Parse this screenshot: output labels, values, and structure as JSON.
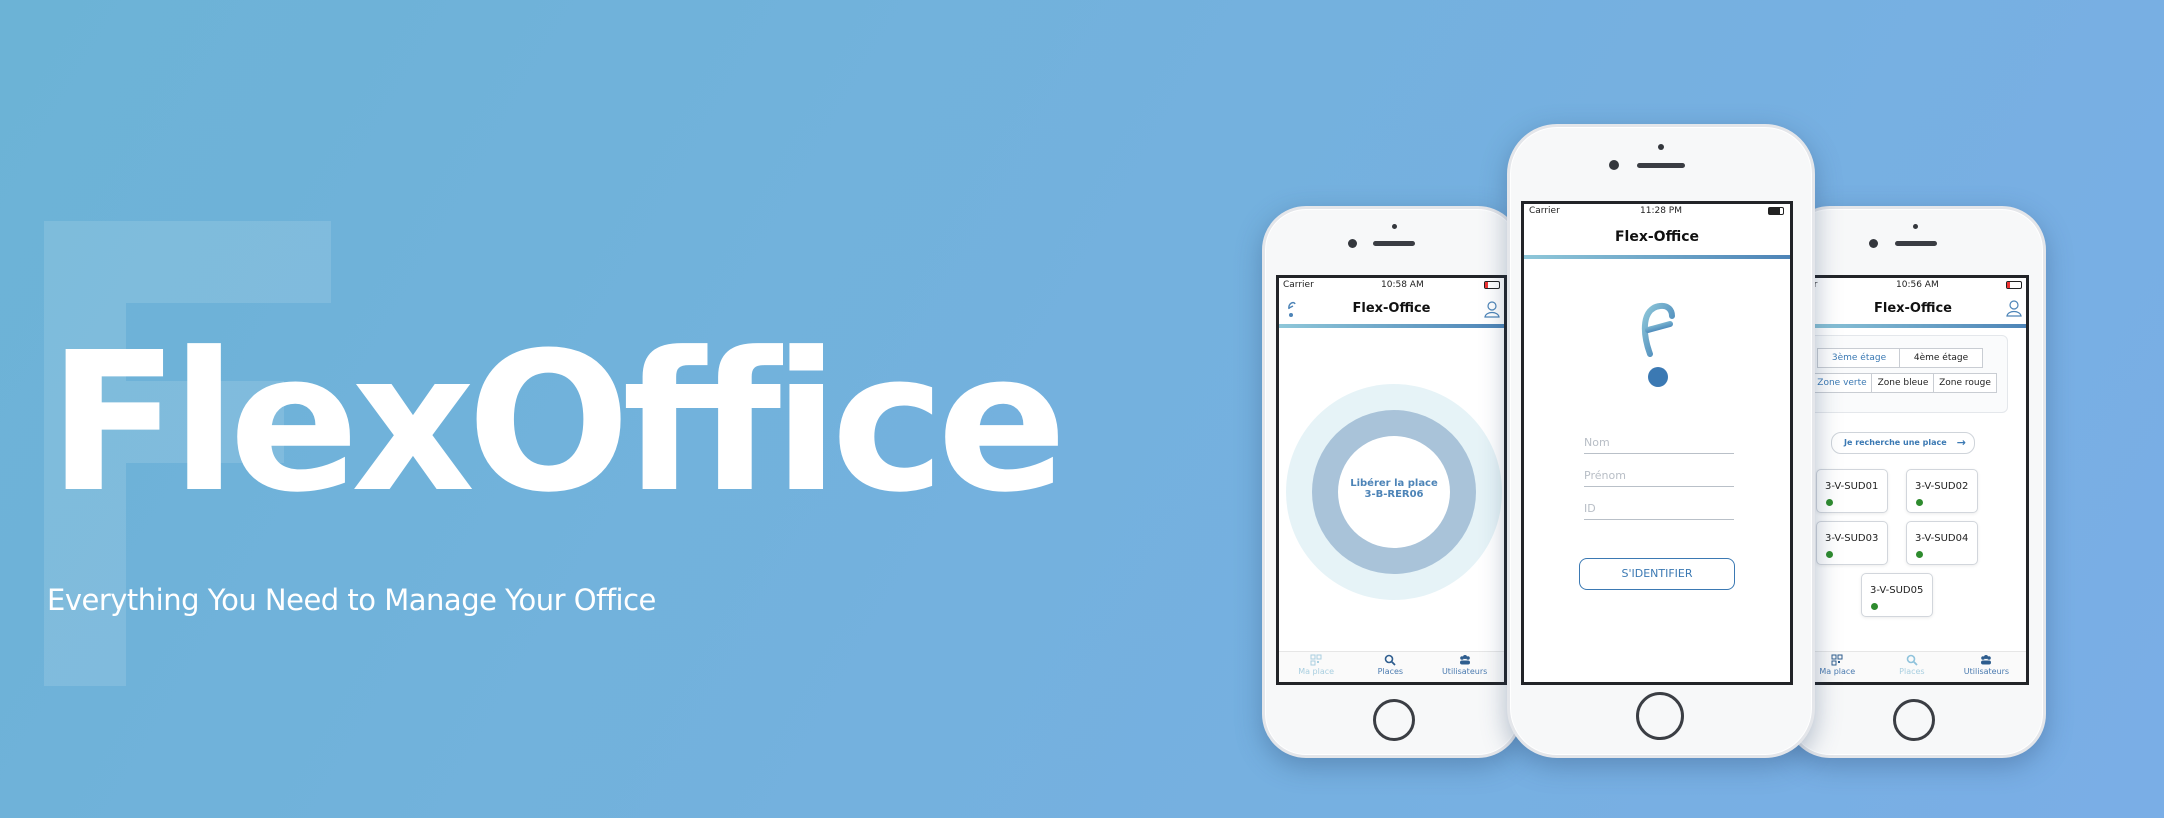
{
  "colors": {
    "accent_blue": "#3b79b3",
    "available_green": "#2e8b2e",
    "background": "#74b1de"
  },
  "banner": {
    "title": "FlexOffice",
    "tagline": "Everything You Need to Manage Your Office"
  },
  "phone_left": {
    "carrier": "Carrier",
    "time": "10:58 AM",
    "app_title": "Flex-Office",
    "release_line1": "Libérer la place",
    "release_line2": "3-B-RER06",
    "tabs": [
      "Ma place",
      "Places",
      "Utilisateurs"
    ]
  },
  "phone_center": {
    "carrier": "Carrier",
    "time": "11:28 PM",
    "app_title": "Flex-Office",
    "fields": {
      "name_placeholder": "Nom",
      "firstname_placeholder": "Prénom",
      "id_placeholder": "ID"
    },
    "login_label": "S'IDENTIFIER"
  },
  "phone_right": {
    "carrier": "rier",
    "time": "10:56 AM",
    "app_title": "Flex-Office",
    "floors": [
      "3ème étage",
      "4ème étage"
    ],
    "zones": [
      "Zone verte",
      "Zone bleue",
      "Zone rouge"
    ],
    "search_label": "Je recherche une place",
    "places": [
      {
        "name": "3-V-SUD01"
      },
      {
        "name": "3-V-SUD02"
      },
      {
        "name": "3-V-SUD03"
      },
      {
        "name": "3-V-SUD04"
      },
      {
        "name": "3-V-SUD05"
      }
    ],
    "tabs": [
      "Ma place",
      "Places",
      "Utilisateurs"
    ]
  },
  "icons": {
    "logo": "flexoffice-logo-icon",
    "wifi": "wifi-icon",
    "battery": "battery-icon",
    "user": "user-icon",
    "qr": "qr-code-icon",
    "search": "search-icon",
    "users": "users-icon",
    "arrow": "arrow-right-icon"
  }
}
